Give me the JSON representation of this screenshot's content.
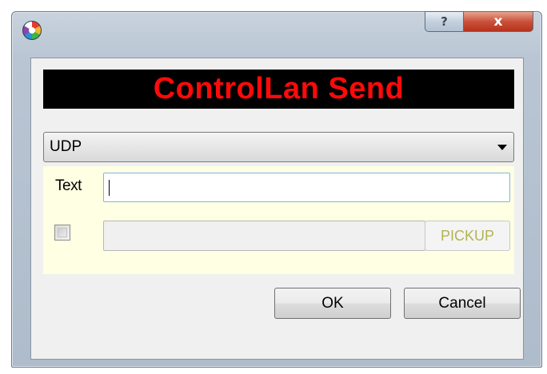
{
  "window": {
    "help_glyph": "?",
    "close_glyph": "x",
    "app_icon": "colorful-wheel-icon"
  },
  "banner": {
    "title": "ControlLan Send",
    "text_color": "#ff0a0a",
    "background": "#000000"
  },
  "protocol_select": {
    "value": "UDP"
  },
  "panel": {
    "background": "#ffffe3",
    "text_label": "Text",
    "text_value": "",
    "checkbox_checked": false,
    "path_value": "",
    "pickup_label": "PICKUP"
  },
  "buttons": {
    "ok": "OK",
    "cancel": "Cancel"
  }
}
